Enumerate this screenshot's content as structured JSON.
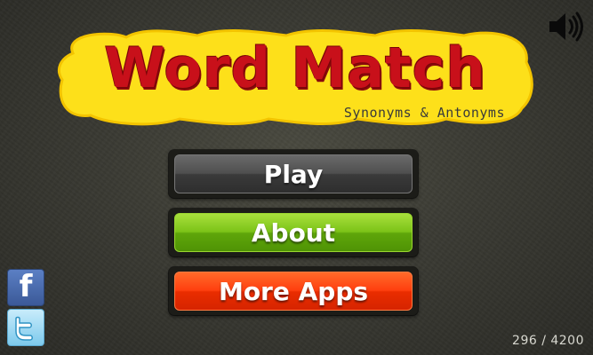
{
  "logo": {
    "title": "Word Match",
    "subtitle": "Synonyms & Antonyms"
  },
  "sound": {
    "icon": "speaker-volume-icon",
    "state": "on"
  },
  "menu": {
    "play_label": "Play",
    "about_label": "About",
    "more_apps_label": "More Apps"
  },
  "social": {
    "facebook_icon": "facebook-icon",
    "twitter_icon": "twitter-icon"
  },
  "counter": "296 / 4200",
  "colors": {
    "logo_bg": "#fde01a",
    "logo_text": "#c8101a",
    "play": "#4a4a4a",
    "about": "#7cc318",
    "more_apps": "#ff3f0f",
    "background": "#3a3a33"
  }
}
